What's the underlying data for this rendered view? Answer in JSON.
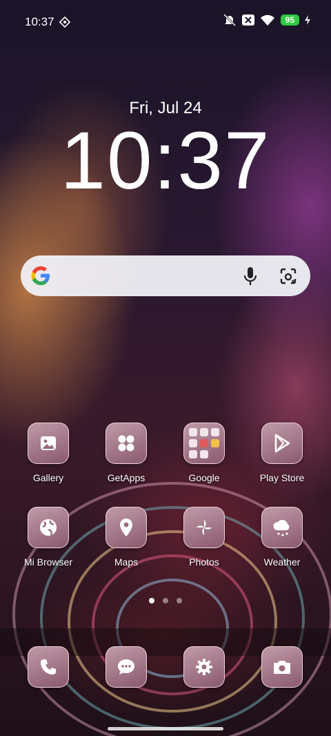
{
  "status_bar": {
    "time": "10:37",
    "battery": "95",
    "icons": [
      "vpn-icon",
      "silent-icon",
      "close-icon",
      "wifi-icon",
      "charging-icon"
    ]
  },
  "lockscreen": {
    "date": "Fri, Jul 24",
    "clock": "10:37"
  },
  "search": {
    "icons": [
      "google-logo-icon",
      "mic-icon",
      "lens-icon"
    ]
  },
  "apps_row1": [
    {
      "label": "Gallery",
      "icon": "gallery-icon"
    },
    {
      "label": "GetApps",
      "icon": "getapps-icon"
    },
    {
      "label": "Google",
      "icon": "folder-icon"
    },
    {
      "label": "Play Store",
      "icon": "play-store-icon"
    }
  ],
  "apps_row2": [
    {
      "label": "Mi Browser",
      "icon": "globe-icon"
    },
    {
      "label": "Maps",
      "icon": "map-pin-icon"
    },
    {
      "label": "Photos",
      "icon": "pinwheel-icon"
    },
    {
      "label": "Weather",
      "icon": "cloud-icon"
    }
  ],
  "dock": [
    {
      "icon": "phone-icon"
    },
    {
      "icon": "messages-icon"
    },
    {
      "icon": "settings-icon"
    },
    {
      "icon": "camera-icon"
    }
  ],
  "page_indicator": {
    "pages": 3,
    "active": 1
  },
  "colors": {
    "tile": "#a87a8c",
    "battery": "#2ecc40"
  }
}
